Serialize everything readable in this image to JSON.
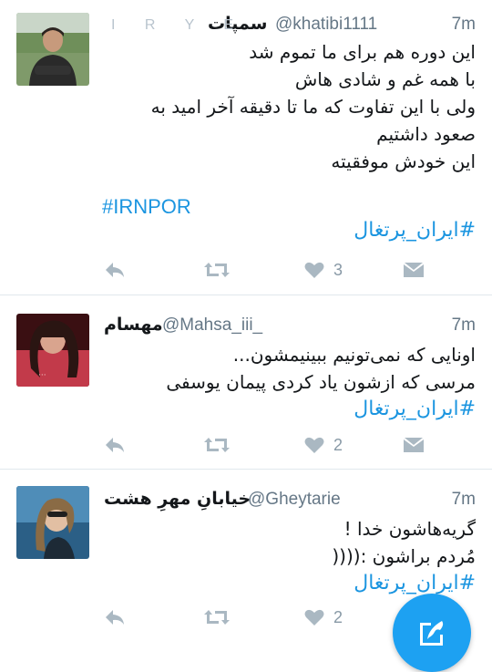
{
  "tweets": [
    {
      "display_name": "سمپات",
      "name_deco": "I R Y E",
      "handle": "@khatibi1111",
      "time": "7m",
      "lines": [
        "این دوره هم برای ما تموم شد",
        "با همه غم و شادی هاش",
        "ولی با این تفاوت که ما تا دقیقه آخر امید به",
        "صعود داشتیم",
        "این خودش موفقیته"
      ],
      "hashtag_latin": "#IRNPOR",
      "hashtag": "#ایران_پرتغال",
      "likes": "3"
    },
    {
      "display_name": "مهسام",
      "handle": "@Mahsa_iii_",
      "time": "7m",
      "lines": [
        "اونایی که نمی‌تونیم ببینیمشون...",
        "مرسی که ازشون یاد کردی پیمان یوسفی"
      ],
      "hashtag": "#ایران_پرتغال",
      "likes": "2"
    },
    {
      "display_name": "خیابانِ مهرِ هشت",
      "handle": "@Gheytarie",
      "time": "7m",
      "lines": [
        "گریه‌هاشون خدا !",
        "مُردم براشون :(((("
      ],
      "hashtag": "#ایران_پرتغال",
      "likes": "2"
    }
  ],
  "icons": {
    "reply": "reply-icon",
    "retweet": "retweet-icon",
    "like": "heart-icon",
    "dm": "envelope-icon",
    "compose": "compose-tweet-icon"
  },
  "colors": {
    "accent": "#1da1f2",
    "hashtag": "#1b95e0",
    "muted": "#657786",
    "action": "#aab8c2"
  }
}
